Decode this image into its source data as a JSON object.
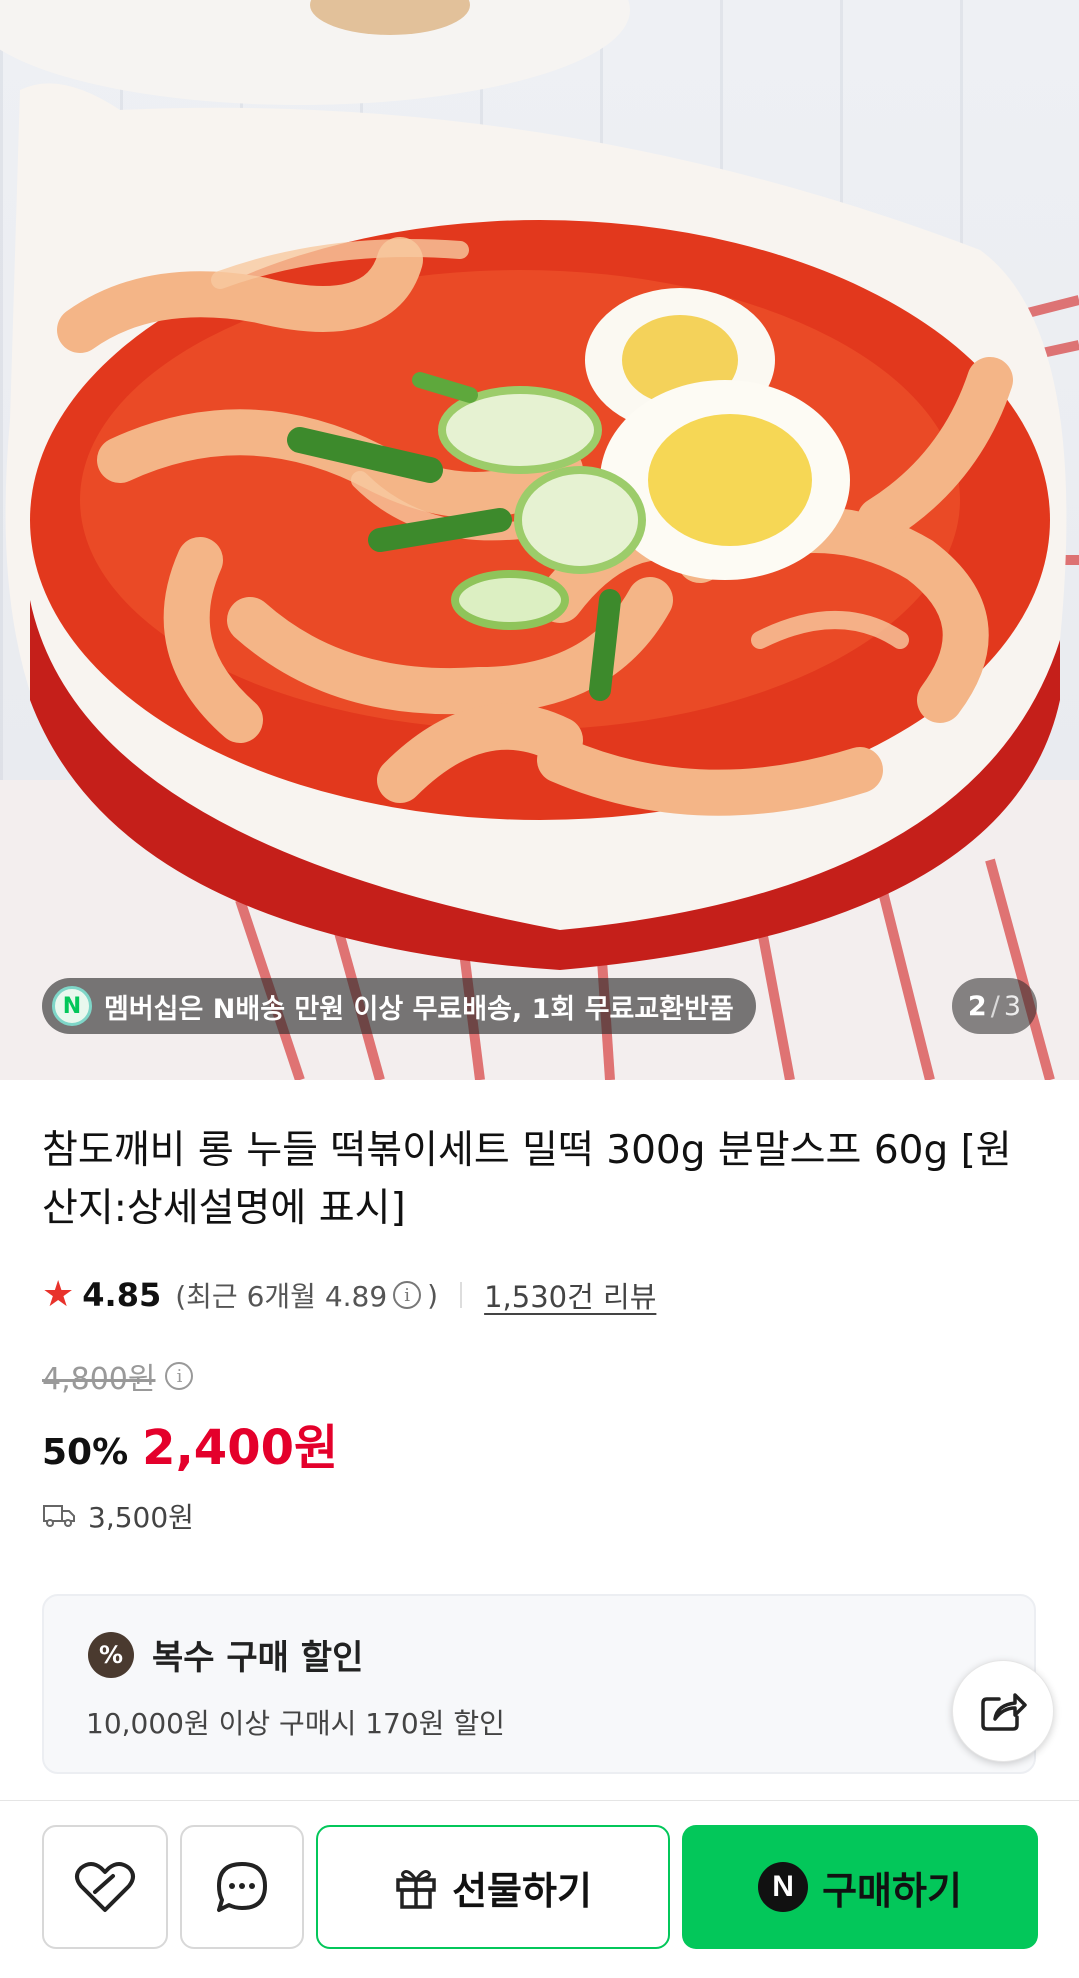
{
  "hero": {
    "image_description": "",
    "badge_text": "멤버십은 N배송 만원 이상 무료배송, 1회 무료교환반품",
    "badge_icon": "naver-n-icon",
    "pager": {
      "current": "2",
      "separator": "/",
      "total": "3"
    }
  },
  "product": {
    "title": "참도깨비 롱 누들 떡볶이세트 밀떡 300g 분말스프 60g [원산지:상세설명에 표시]",
    "rating": {
      "score": "4.85",
      "recent_text": "(최근 6개월 4.89",
      "recent_close": ")",
      "info_icon": "i",
      "reviews": "1,530건 리뷰"
    },
    "original_price": "4,800원",
    "discount_rate": "50%",
    "sale_price": "2,400원",
    "shipping_fee": "3,500원"
  },
  "bulk_discount": {
    "icon_text": "%",
    "title": "복수 구매 할인",
    "description": "10,000원 이상 구매시 170원 할인"
  },
  "bottom_bar": {
    "gift_label": "선물하기",
    "buy_label": "구매하기",
    "buy_icon_text": "N"
  },
  "colors": {
    "accent_green": "#03c75a",
    "price_red": "#e4002b",
    "star_red": "#e8322b"
  }
}
